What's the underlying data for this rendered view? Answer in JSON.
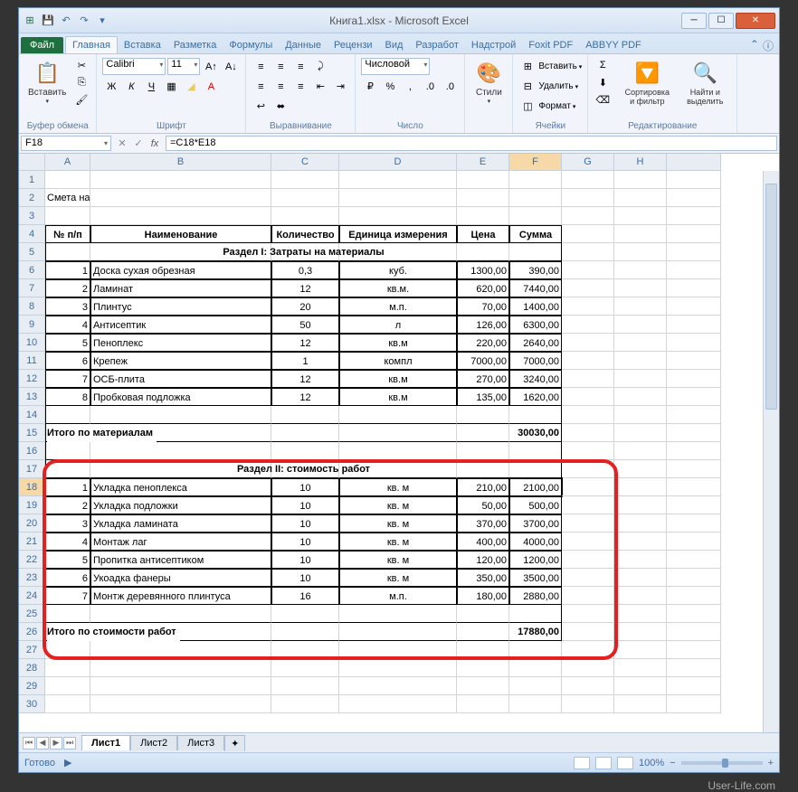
{
  "window": {
    "title": "Книга1.xlsx - Microsoft Excel"
  },
  "tabs": {
    "file": "Файл",
    "home": "Главная",
    "insert": "Вставка",
    "layout": "Разметка",
    "formulas": "Формулы",
    "data": "Данные",
    "review": "Рецензи",
    "view": "Вид",
    "dev": "Разработ",
    "addin": "Надстрой",
    "foxit": "Foxit PDF",
    "abbyy": "ABBYY PDF"
  },
  "ribbon": {
    "clipboard": {
      "paste": "Вставить",
      "label": "Буфер обмена"
    },
    "font": {
      "name": "Calibri",
      "size": "11",
      "label": "Шрифт"
    },
    "alignment": {
      "label": "Выравнивание"
    },
    "number": {
      "format": "Числовой",
      "label": "Число"
    },
    "styles": {
      "btn": "Стили",
      "label": ""
    },
    "cells": {
      "insert": "Вставить",
      "delete": "Удалить",
      "format": "Формат",
      "label": "Ячейки"
    },
    "editing": {
      "sort": "Сортировка и фильтр",
      "find": "Найти и выделить",
      "label": "Редактирование"
    }
  },
  "namebox": "F18",
  "formula": "=C18*E18",
  "columns": [
    "A",
    "B",
    "C",
    "D",
    "E",
    "F",
    "G",
    "H"
  ],
  "rows_count": 30,
  "chart_data": {
    "type": "table",
    "title": "Смета на работы",
    "headers": {
      "num": "№ п/п",
      "name": "Наименование",
      "qty": "Количество",
      "unit": "Единица измерения",
      "price": "Цена",
      "sum": "Сумма"
    },
    "section1_title": "Раздел I: Затраты на материалы",
    "section1_rows": [
      {
        "n": 1,
        "name": "Доска сухая обрезная",
        "qty": "0,3",
        "unit": "куб.",
        "price": "1300,00",
        "sum": "390,00"
      },
      {
        "n": 2,
        "name": "Ламинат",
        "qty": "12",
        "unit": "кв.м.",
        "price": "620,00",
        "sum": "7440,00"
      },
      {
        "n": 3,
        "name": "Плинтус",
        "qty": "20",
        "unit": "м.п.",
        "price": "70,00",
        "sum": "1400,00"
      },
      {
        "n": 4,
        "name": "Антисептик",
        "qty": "50",
        "unit": "л",
        "price": "126,00",
        "sum": "6300,00"
      },
      {
        "n": 5,
        "name": "Пеноплекс",
        "qty": "12",
        "unit": "кв.м",
        "price": "220,00",
        "sum": "2640,00"
      },
      {
        "n": 6,
        "name": "Крепеж",
        "qty": "1",
        "unit": "компл",
        "price": "7000,00",
        "sum": "7000,00"
      },
      {
        "n": 7,
        "name": "ОСБ-плита",
        "qty": "12",
        "unit": "кв.м",
        "price": "270,00",
        "sum": "3240,00"
      },
      {
        "n": 8,
        "name": "Пробковая подложка",
        "qty": "12",
        "unit": "кв.м",
        "price": "135,00",
        "sum": "1620,00"
      }
    ],
    "section1_total_label": "Итого по материалам",
    "section1_total": "30030,00",
    "section2_title": "Раздел II: стоимость работ",
    "section2_rows": [
      {
        "n": 1,
        "name": "Укладка пеноплекса",
        "qty": "10",
        "unit": "кв. м",
        "price": "210,00",
        "sum": "2100,00"
      },
      {
        "n": 2,
        "name": "Укладка подложки",
        "qty": "10",
        "unit": "кв. м",
        "price": "50,00",
        "sum": "500,00"
      },
      {
        "n": 3,
        "name": "Укладка  ламината",
        "qty": "10",
        "unit": "кв. м",
        "price": "370,00",
        "sum": "3700,00"
      },
      {
        "n": 4,
        "name": "Монтаж лаг",
        "qty": "10",
        "unit": "кв. м",
        "price": "400,00",
        "sum": "4000,00"
      },
      {
        "n": 5,
        "name": "Пропитка антисептиком",
        "qty": "10",
        "unit": "кв. м",
        "price": "120,00",
        "sum": "1200,00"
      },
      {
        "n": 6,
        "name": "Укоадка фанеры",
        "qty": "10",
        "unit": "кв. м",
        "price": "350,00",
        "sum": "3500,00"
      },
      {
        "n": 7,
        "name": "Монтж деревянного плинтуса",
        "qty": "16",
        "unit": "м.п.",
        "price": "180,00",
        "sum": "2880,00"
      }
    ],
    "section2_total_label": "Итого по стоимости работ",
    "section2_total": "17880,00"
  },
  "sheets": {
    "s1": "Лист1",
    "s2": "Лист2",
    "s3": "Лист3"
  },
  "status": {
    "ready": "Готово",
    "zoom": "100%"
  },
  "watermark": "User-Life.com"
}
